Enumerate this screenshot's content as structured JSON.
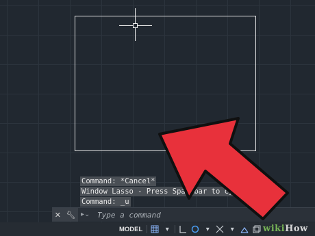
{
  "history": [
    "Command: *Cancel*",
    "Window Lasso - Press Spacebar to cycle",
    "Command: _u"
  ],
  "command_line": {
    "placeholder": "Type a command",
    "prompt_icon": "command-prompt-icon"
  },
  "status_bar": {
    "model_label": "MODEL"
  },
  "watermark": {
    "wiki": "wiki",
    "how": "How"
  },
  "colors": {
    "canvas": "#212830",
    "grid": "#2c343d",
    "arrow": "#e8313b",
    "selection": "#e8e8e8"
  }
}
